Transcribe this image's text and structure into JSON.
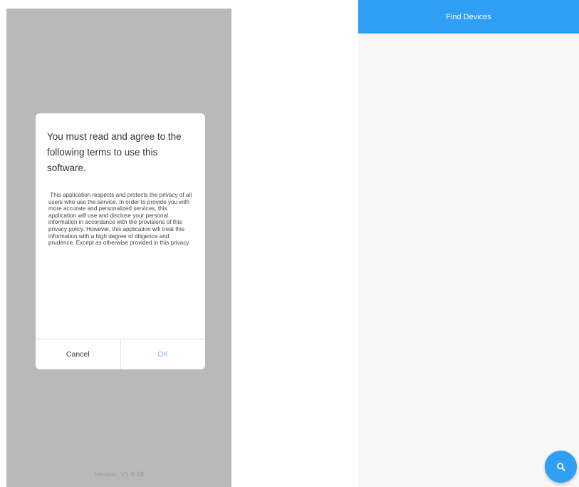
{
  "left_screen": {
    "dialog": {
      "title": "You must read and agree to the following terms to use this software.",
      "body": " This application respects and protects the privacy of all users who use the service. In order to provide you with more accurate and personalized services, this application will use and disclose your personal information in accordance with the provisions of this privacy policy. However, this application will treat this information with a high degree of diligence and prudence. Except as otherwise provided in this privacy",
      "cancel_label": "Cancel",
      "ok_label": "OK"
    },
    "version": "Version: V1.0.18"
  },
  "right_screen": {
    "app_bar_title": "Find Devices",
    "fab_icon": "search-icon"
  },
  "colors": {
    "accent": "#2f9ef5",
    "overlay": "#b9b9b9",
    "ok_text": "#8ab4f8"
  }
}
